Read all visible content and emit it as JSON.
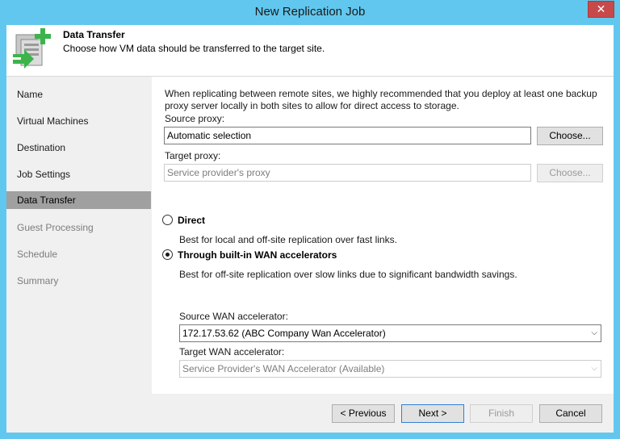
{
  "window": {
    "title": "New Replication Job",
    "close_glyph": "✕"
  },
  "header": {
    "title": "Data Transfer",
    "description": "Choose how VM data should be transferred to the target site.",
    "icon": "replication-transfer-icon"
  },
  "sidebar": {
    "items": [
      {
        "label": "Name",
        "state": "normal"
      },
      {
        "label": "Virtual Machines",
        "state": "normal"
      },
      {
        "label": "Destination",
        "state": "normal"
      },
      {
        "label": "Job Settings",
        "state": "normal"
      },
      {
        "label": "Data Transfer",
        "state": "active"
      },
      {
        "label": "Guest Processing",
        "state": "disabled"
      },
      {
        "label": "Schedule",
        "state": "disabled"
      },
      {
        "label": "Summary",
        "state": "disabled"
      }
    ]
  },
  "content": {
    "info": "When replicating between remote sites, we highly recommended that you deploy at least one backup proxy server locally in both sites to allow for direct access to storage.",
    "source_proxy": {
      "label": "Source proxy:",
      "value": "Automatic selection",
      "button": "Choose..."
    },
    "target_proxy": {
      "label": "Target proxy:",
      "value": "Service provider's proxy",
      "button": "Choose..."
    },
    "direct": {
      "label": "Direct",
      "description": "Best for local and off-site replication over fast links.",
      "selected": false
    },
    "wan": {
      "label": "Through built-in WAN accelerators",
      "description": "Best for off-site replication over slow links due to significant bandwidth savings.",
      "selected": true,
      "source_label": "Source WAN accelerator:",
      "source_value": "172.17.53.62 (ABC Company Wan Accelerator)",
      "target_label": "Target WAN accelerator:",
      "target_value": "Service Provider's WAN Accelerator (Available)"
    }
  },
  "footer": {
    "previous": "< Previous",
    "next": "Next >",
    "finish": "Finish",
    "cancel": "Cancel"
  },
  "colors": {
    "titlebar": "#62c7ee",
    "close": "#c74a4a",
    "active_nav": "#a0a0a0",
    "icon_green": "#3cb44b"
  }
}
